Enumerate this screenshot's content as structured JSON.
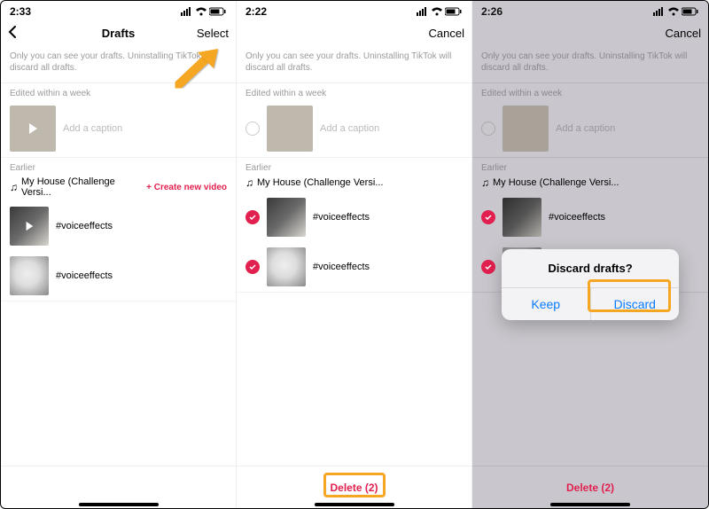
{
  "status": {
    "t1": "2:33",
    "t2": "2:22",
    "t3": "2:26"
  },
  "nav": {
    "title": "Drafts",
    "select": "Select",
    "cancel": "Cancel"
  },
  "hint": "Only you can see your drafts. Uninstalling TikTok will discard all drafts.",
  "sections": {
    "week": "Edited within a week",
    "earlier": "Earlier"
  },
  "caption_placeholder": "Add a caption",
  "song": "My House (Challenge Versi...",
  "create": "+ Create new video",
  "items": {
    "a": "#voiceeffects",
    "b": "#voiceeffects"
  },
  "delete": "Delete (2)",
  "dialog": {
    "title": "Discard drafts?",
    "keep": "Keep",
    "discard": "Discard"
  }
}
